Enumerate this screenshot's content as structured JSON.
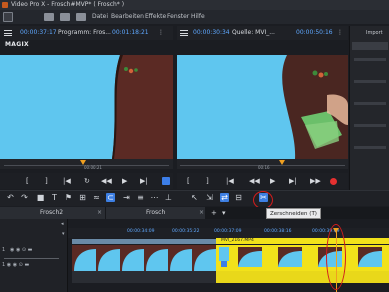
{
  "window": {
    "title": "Video Pro X - Frosch#MVP* ( Frosch* )"
  },
  "menu": {
    "items": [
      "Datei",
      "Bearbeiten",
      "Effekte",
      "Fenster",
      "Hilfe"
    ]
  },
  "brand": {
    "logo_text": "MAGIX"
  },
  "program_monitor": {
    "timecode_left": "00:00:37:17",
    "label": "Programm: Fros...",
    "timecode_right": "00:01:18:21",
    "scrub_time": "00:00:21"
  },
  "source_monitor": {
    "timecode_left": "00:00:30:34",
    "label": "Quelle: MVI_...",
    "timecode_right": "00:00:50:16",
    "scrub_time": "00:16"
  },
  "right_panel": {
    "title": "Import"
  },
  "tooltip": {
    "text": "Zerschneiden (T)"
  },
  "tabs": [
    {
      "label": "Frosch2",
      "close": "×"
    },
    {
      "label": "Frosch",
      "close": "×"
    }
  ],
  "tab_actions": {
    "add": "+",
    "more": "▾"
  },
  "timeline": {
    "ruler_labels": [
      "00:00:34:09",
      "00:00:35:22",
      "00:00:37:09",
      "00:00:38:16",
      "00:00:39:09"
    ],
    "clip_name": "MVI_2167.MP4",
    "track_number": "1"
  },
  "transport_left": {
    "in": "[",
    "out": "]",
    "prev": "|◀",
    "back": "◀◀",
    "play": "▶",
    "next": "▶|",
    "loop": "↻"
  },
  "transport_right": {
    "in": "[",
    "out": "]",
    "prev": "|◀",
    "back": "◀◀",
    "play": "▶",
    "next": "▶|"
  },
  "colors": {
    "accent": "#3d7fe3",
    "timecode": "#5fa8ff",
    "clip_yellow": "#f2e21a",
    "sky": "#5fc6ef",
    "highlight_red": "#d21c1c",
    "marker": "#f0a020"
  }
}
